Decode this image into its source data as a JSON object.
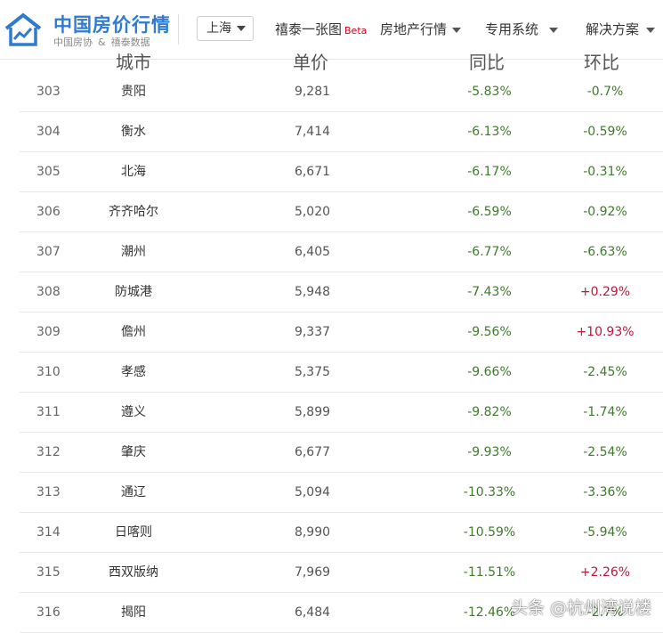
{
  "brand": {
    "title": "中国房价行情",
    "sub_left": "中国房协",
    "sub_amp": "&",
    "sub_right": "禧泰数据"
  },
  "city_select": {
    "value": "上海"
  },
  "nav": {
    "item1": "禧泰一张图",
    "item1_badge": "Beta",
    "item2": "房地产行情",
    "item3": "专用系统",
    "item4": "解决方案"
  },
  "columns": {
    "city": "城市",
    "price": "单价",
    "yoy": "同比",
    "mom": "环比"
  },
  "rows": [
    {
      "rank": "303",
      "city": "贵阳",
      "price": "9,281",
      "yoy": "-5.83%",
      "mom": "-0.7%"
    },
    {
      "rank": "304",
      "city": "衡水",
      "price": "7,414",
      "yoy": "-6.13%",
      "mom": "-0.59%"
    },
    {
      "rank": "305",
      "city": "北海",
      "price": "6,671",
      "yoy": "-6.17%",
      "mom": "-0.31%"
    },
    {
      "rank": "306",
      "city": "齐齐哈尔",
      "price": "5,020",
      "yoy": "-6.59%",
      "mom": "-0.92%"
    },
    {
      "rank": "307",
      "city": "潮州",
      "price": "6,405",
      "yoy": "-6.77%",
      "mom": "-6.63%"
    },
    {
      "rank": "308",
      "city": "防城港",
      "price": "5,948",
      "yoy": "-7.43%",
      "mom": "+0.29%"
    },
    {
      "rank": "309",
      "city": "儋州",
      "price": "9,337",
      "yoy": "-9.56%",
      "mom": "+10.93%"
    },
    {
      "rank": "310",
      "city": "孝感",
      "price": "5,375",
      "yoy": "-9.66%",
      "mom": "-2.45%"
    },
    {
      "rank": "311",
      "city": "遵义",
      "price": "5,899",
      "yoy": "-9.82%",
      "mom": "-1.74%"
    },
    {
      "rank": "312",
      "city": "肇庆",
      "price": "6,677",
      "yoy": "-9.93%",
      "mom": "-2.54%"
    },
    {
      "rank": "313",
      "city": "通辽",
      "price": "5,094",
      "yoy": "-10.33%",
      "mom": "-3.36%"
    },
    {
      "rank": "314",
      "city": "日喀则",
      "price": "8,990",
      "yoy": "-10.59%",
      "mom": "-5.94%"
    },
    {
      "rank": "315",
      "city": "西双版纳",
      "price": "7,969",
      "yoy": "-11.51%",
      "mom": "+2.26%"
    },
    {
      "rank": "316",
      "city": "揭阳",
      "price": "6,484",
      "yoy": "-12.46%",
      "mom": "-2.7%"
    }
  ],
  "watermark": "头条 @杭州湾说楼",
  "colors": {
    "brand_blue": "#2f7bd1",
    "negative_green": "#3f7a2b",
    "positive_red": "#c0163a",
    "beta_red": "#d0021b"
  },
  "icons": {
    "logo": "house-chart-logo-icon",
    "dropdown": "caret-down-icon"
  }
}
